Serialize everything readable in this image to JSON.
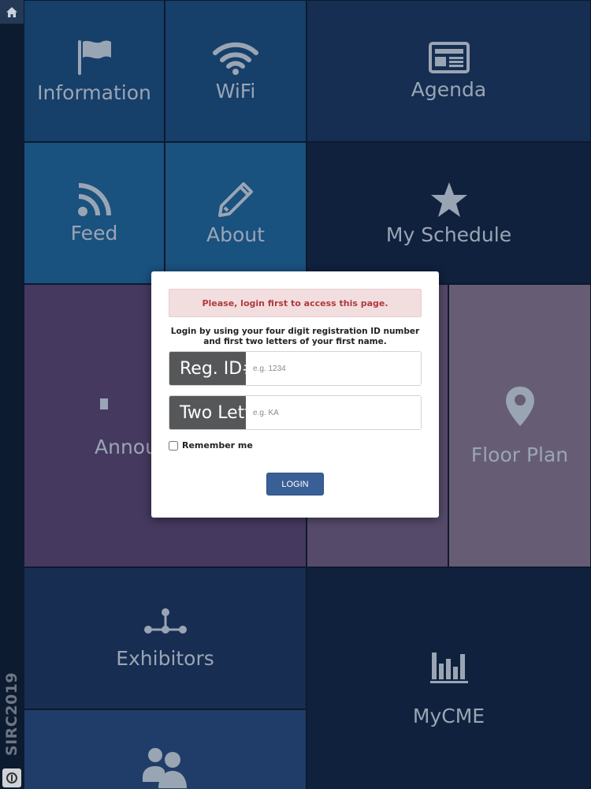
{
  "app": {
    "sidebar_title": "SIRC2019"
  },
  "icons": {
    "home": "home-icon",
    "logo": "logo-icon",
    "information": "flag-icon",
    "wifi": "wifi-icon",
    "agenda": "newspaper-icon",
    "feed": "rss-icon",
    "about": "pencil-icon",
    "my_schedule": "star-icon",
    "announcements": "megaphone-icon",
    "floor_plan": "map-marker-icon",
    "exhibitors": "network-icon",
    "mycme": "bar-chart-icon",
    "attendees": "users-icon"
  },
  "tiles": {
    "information": "Information",
    "wifi": "WiFi",
    "agenda": "Agenda",
    "feed": "Feed",
    "about": "About",
    "my_schedule": "My Schedule",
    "announcements": "Annou",
    "floor_plan": "Floor Plan",
    "exhibitors": "Exhibitors",
    "mycme": "MyCME"
  },
  "modal": {
    "alert": "Please, login first to access this page.",
    "instructions": "Login by using your four digit registration ID number and first two letters of your first name.",
    "reg_id_label": "Reg. ID#",
    "reg_id_placeholder": "e.g. 1234",
    "two_letters_label": "Two Letters",
    "two_letters_placeholder": "e.g. KA",
    "remember_label": "Remember me",
    "login_label": "LOGIN"
  },
  "colors": {
    "modal_button": "#386096",
    "alert_text": "#b03a3d",
    "alert_background": "#f2dedf"
  }
}
